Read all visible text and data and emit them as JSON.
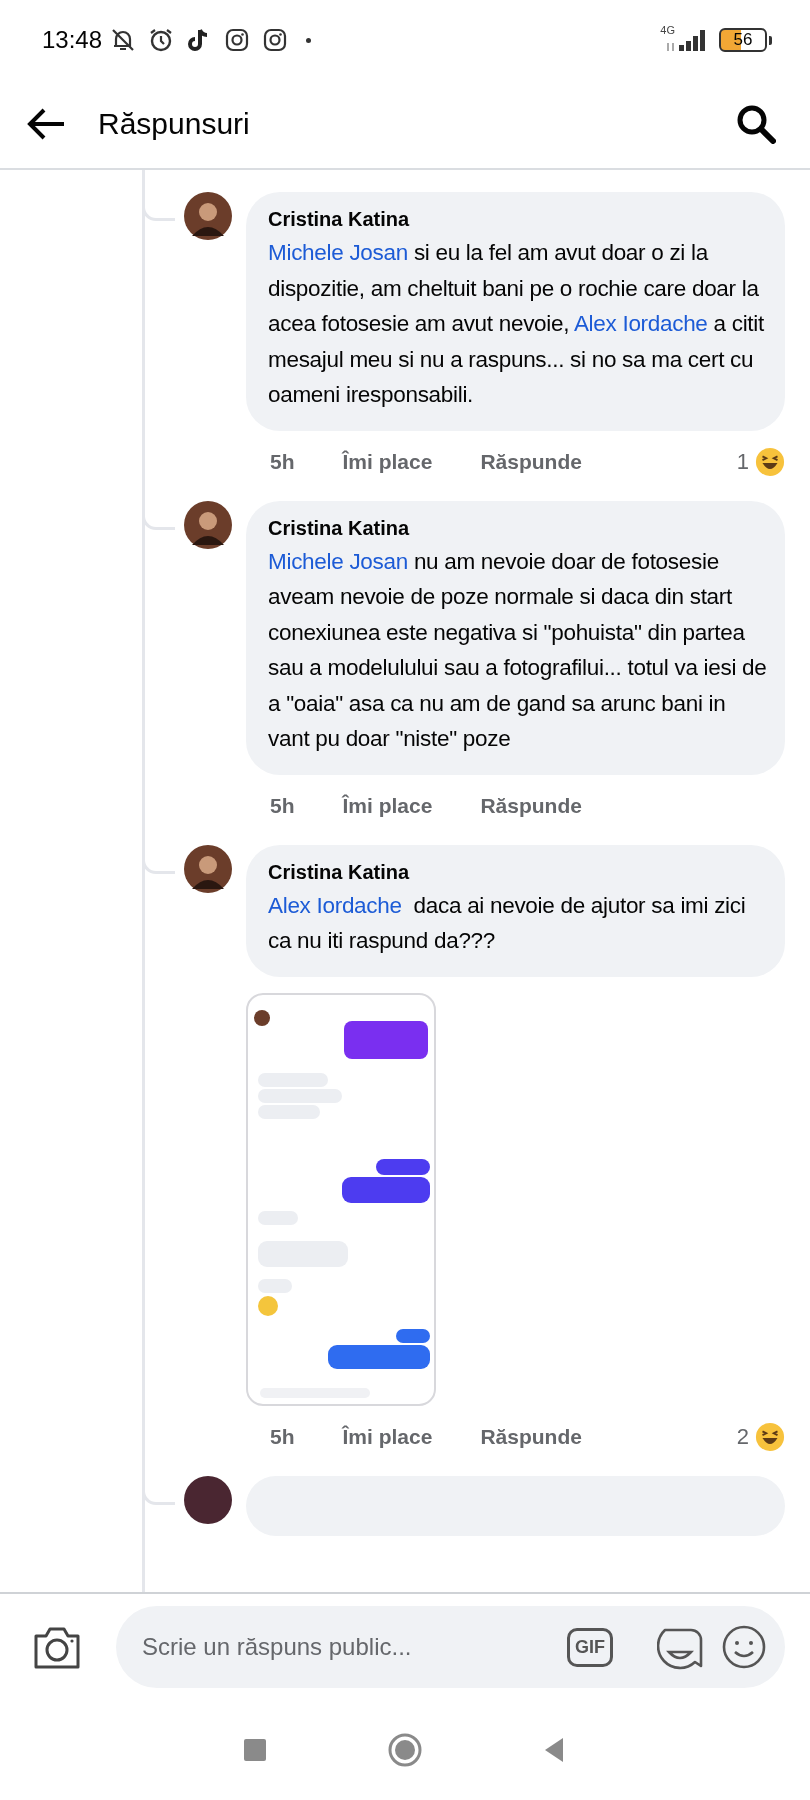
{
  "status_bar": {
    "time": "13:48",
    "network": "4G",
    "battery": "56"
  },
  "header": {
    "title": "Răspunsuri"
  },
  "comments": [
    {
      "kind": "full",
      "author": "Cristina Katina",
      "body": [
        {
          "kind": "mention",
          "text": "Michele Josan"
        },
        {
          "kind": "text",
          "text": " si eu la fel am avut doar o zi la dispozitie, am cheltuit bani pe o rochie care doar la acea fotosesie am avut nevoie, "
        },
        {
          "kind": "mention",
          "text": "Alex Iordache"
        },
        {
          "kind": "text",
          "text": " a citit mesajul meu si nu a raspuns... si no sa ma cert cu oameni iresponsabili."
        }
      ],
      "time": "5h",
      "like": "Îmi place",
      "reply": "Răspunde",
      "reaction": {
        "kind": "haha",
        "count": "1"
      }
    },
    {
      "kind": "full",
      "author": "Cristina Katina",
      "body": [
        {
          "kind": "mention",
          "text": "Michele Josan"
        },
        {
          "kind": "text",
          "text": " nu am nevoie doar de fotosesie aveam nevoie de poze normale si daca din start conexiunea este negativa si \"pohuista\" din partea sau a modelulului sau a fotografilui... totul va iesi de a \"oaia\" asa ca nu am de gand sa arunc bani in vant pu doar \"niste\" poze"
        }
      ],
      "time": "5h",
      "like": "Îmi place",
      "reply": "Răspunde"
    },
    {
      "kind": "full",
      "author": "Cristina Katina",
      "body": [
        {
          "kind": "mention",
          "text": "Alex Iordache"
        },
        {
          "kind": "text",
          "text": "  daca ai nevoie de ajutor sa imi zici ca nu iti raspund da???"
        }
      ],
      "time": "5h",
      "like": "Îmi place",
      "reply": "Răspunde",
      "reaction": {
        "kind": "haha",
        "count": "2"
      }
    },
    {
      "kind": "cut"
    }
  ],
  "composer": {
    "placeholder": "Scrie un răspuns public...",
    "gif": "GIF"
  }
}
